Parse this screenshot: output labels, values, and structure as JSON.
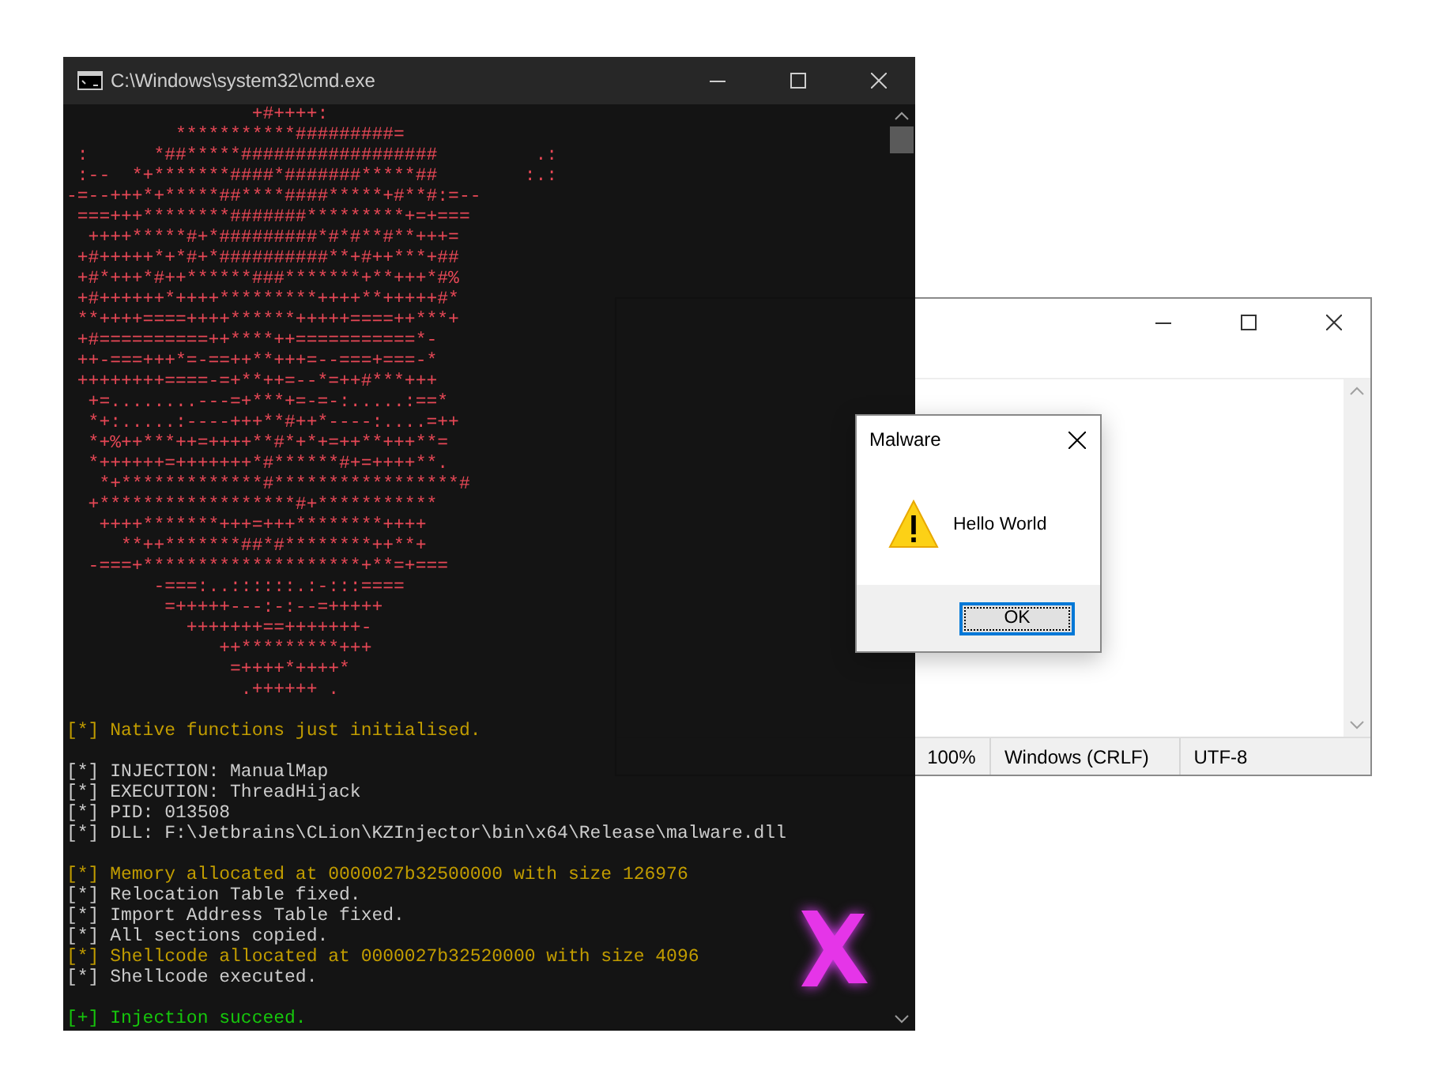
{
  "console_window": {
    "title": "C:\\Windows\\system32\\cmd.exe",
    "ascii_art": [
      "                 +#++++:",
      "          ***********#########=",
      " :      *##*****##################         .:",
      " :--  *+*******####*#######*****##        :.:",
      "-=--+++*+*****##****####*****+#**#:=--",
      " ===+++********#######*********+=+===",
      "  ++++*****#+*#########*#*#**#**+++=",
      " +#+++++*+*#+*##########**+#++***+##",
      " +#*+++*#++******###*******+**+++*#%",
      " +#++++++*++++*********++++**+++++#*",
      " **++++====++++******+++++====++***+",
      " +#==========++****++===========*-",
      " ++-===+++*=-==++**+++=--===+===-*",
      " ++++++++====-=+**++=--*=++#***+++",
      "  +=........---=+***+=-=-:.....:==*",
      "  *+:.....:----+++**#++*----:....=++",
      "  *+%++***++=++++**#*+*+=++**+++**=",
      "  *++++++=+++++++*#******#+=++++**.",
      "   *+*************#*****************#",
      "  +******************#+***********",
      "   ++++*******+++=+++********++++",
      "     **++*******##*#********++**+",
      "  -===+********************+**=+===",
      "        -===:..::::::.:-:::====",
      "         =+++++---:-:--=+++++",
      "           +++++++==+++++++-",
      "              ++*********+++",
      "               =++++*++++*",
      "                .++++++ ."
    ],
    "log_groups": [
      [
        {
          "kind": "notice",
          "text": "[*] Native functions just initialised."
        }
      ],
      [
        {
          "kind": "info",
          "text": "[*] INJECTION: ManualMap"
        },
        {
          "kind": "info",
          "text": "[*] EXECUTION: ThreadHijack"
        },
        {
          "kind": "info",
          "text": "[*] PID: 013508"
        },
        {
          "kind": "info",
          "text": "[*] DLL: F:\\Jetbrains\\CLion\\KZInjector\\bin\\x64\\Release\\malware.dll"
        }
      ],
      [
        {
          "kind": "notice",
          "text": "[*] Memory allocated at 0000027b32500000 with size 126976"
        },
        {
          "kind": "info",
          "text": "[*] Relocation Table fixed."
        },
        {
          "kind": "info",
          "text": "[*] Import Address Table fixed."
        },
        {
          "kind": "info",
          "text": "[*] All sections copied."
        },
        {
          "kind": "notice",
          "text": "[*] Shellcode allocated at 0000027b32520000 with size 4096"
        },
        {
          "kind": "info",
          "text": "[*] Shellcode executed."
        }
      ],
      [
        {
          "kind": "success",
          "text": "[+] Injection succeed."
        }
      ]
    ]
  },
  "notepad_window": {
    "status_bar": [
      "100%",
      "Windows (CRLF)",
      "UTF-8"
    ]
  },
  "message_box": {
    "title": "Malware",
    "message": "Hello World",
    "buttons": [
      {
        "label": "OK",
        "focused": true
      }
    ]
  }
}
